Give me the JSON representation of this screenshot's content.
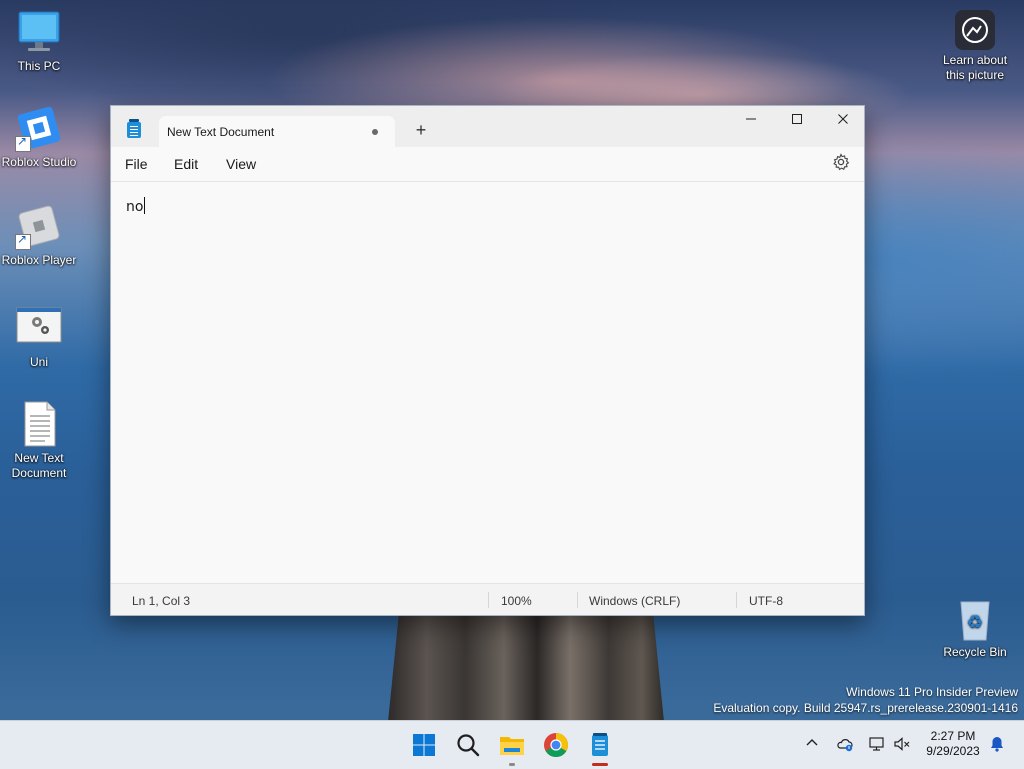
{
  "desktop": {
    "icons": [
      {
        "label": "This PC",
        "icon": "monitor-icon"
      },
      {
        "label": "Roblox Studio",
        "icon": "roblox-studio-icon"
      },
      {
        "label": "Roblox Player",
        "icon": "roblox-player-icon"
      },
      {
        "label": "Uni",
        "icon": "settings-window-icon"
      },
      {
        "label": "New Text Document",
        "icon": "text-file-icon"
      },
      {
        "label": "Recycle Bin",
        "icon": "recycle-bin-icon"
      }
    ],
    "learn_about": "Learn about this picture",
    "watermark_line1": "Windows 11 Pro Insider Preview",
    "watermark_line2": "Evaluation copy. Build 25947.rs_prerelease.230901-1416"
  },
  "notepad": {
    "tab_title": "New Text Document",
    "new_tab_symbol": "+",
    "window_controls": {
      "minimize": "—",
      "maximize": "☐",
      "close": "✕"
    },
    "menu": [
      "File",
      "Edit",
      "View"
    ],
    "content": "no",
    "status": {
      "position": "Ln 1, Col 3",
      "zoom": "100%",
      "line_ending": "Windows (CRLF)",
      "encoding": "UTF-8"
    }
  },
  "taskbar": {
    "apps": [
      "start-icon",
      "search-icon",
      "file-explorer-icon",
      "chrome-icon",
      "notepad-icon"
    ],
    "tray_chevron": "^",
    "time": "2:27 PM",
    "date": "9/29/2023"
  },
  "colors": {
    "accent": "#0067c0",
    "notepad_blue": "#1d8fd8",
    "active_indicator": "#c42b1c"
  }
}
